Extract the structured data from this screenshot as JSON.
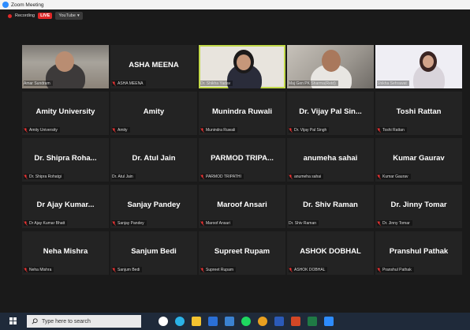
{
  "window": {
    "title": "Zoom Meeting"
  },
  "recording": {
    "label": "Recording",
    "live": "LIVE",
    "stream": "YouTube"
  },
  "tiles": [
    {
      "big": "",
      "name": "Amar Sundram",
      "muted": false,
      "video": "v1"
    },
    {
      "big": "ASHA MEENA",
      "name": "ASHA MEENA",
      "muted": true,
      "video": ""
    },
    {
      "big": "",
      "name": "Dr. Shikha Yadav",
      "muted": false,
      "video": "v3"
    },
    {
      "big": "",
      "name": "Maj Gen PK Sharma(Retd)",
      "muted": false,
      "video": "v4"
    },
    {
      "big": "",
      "name": "Shikha Sehrawat",
      "muted": false,
      "video": "v5"
    },
    {
      "big": "Amity University",
      "name": "Amity University",
      "muted": true
    },
    {
      "big": "Amity",
      "name": "Amity",
      "muted": true
    },
    {
      "big": "Munindra Ruwali",
      "name": "Munindra Ruwali",
      "muted": true
    },
    {
      "big": "Dr. Vijay Pal Sin...",
      "name": "Dr. Vijay Pal Singh",
      "muted": true
    },
    {
      "big": "Toshi Rattan",
      "name": "Toshi Rattan",
      "muted": true
    },
    {
      "big": "Dr. Shipra Roha...",
      "name": "Dr. Shipra Rohatgi",
      "muted": true
    },
    {
      "big": "Dr. Atul Jain",
      "name": "Dr. Atul Jain",
      "muted": false
    },
    {
      "big": "PARMOD TRIPA...",
      "name": "PARMOD TRIPATHI",
      "muted": true
    },
    {
      "big": "anumeha sahai",
      "name": "anumeha sahai",
      "muted": true
    },
    {
      "big": "Kumar Gaurav",
      "name": "Kumar Gaurav",
      "muted": true
    },
    {
      "big": "Dr Ajay Kumar...",
      "name": "Dr Ajay Kumar Bhatt",
      "muted": true
    },
    {
      "big": "Sanjay Pandey",
      "name": "Sanjay Pandey",
      "muted": true
    },
    {
      "big": "Maroof Ansari",
      "name": "Maroof Ansari",
      "muted": true
    },
    {
      "big": "Dr. Shiv Raman",
      "name": "Dr. Shiv Raman",
      "muted": false
    },
    {
      "big": "Dr. Jinny Tomar",
      "name": "Dr. Jinny Tomar",
      "muted": true
    },
    {
      "big": "Neha Mishra",
      "name": "Neha Mishra",
      "muted": true
    },
    {
      "big": "Sanjum Bedi",
      "name": "Sanjum Bedi",
      "muted": true
    },
    {
      "big": "Supreet Rupam",
      "name": "Supreet Rupam",
      "muted": true
    },
    {
      "big": "ASHOK DOBHAL",
      "name": "ASHOK DOBHAL",
      "muted": true
    },
    {
      "big": "Pranshul Pathak",
      "name": "Pranshul Pathak",
      "muted": true
    }
  ],
  "taskbar": {
    "search_placeholder": "Type here to search",
    "icons": [
      {
        "name": "cortana-icon",
        "color": "#ffffff"
      },
      {
        "name": "edge-icon",
        "color": "#2bb3e8"
      },
      {
        "name": "file-explorer-icon",
        "color": "#f2c230"
      },
      {
        "name": "calendar-icon",
        "color": "#2a6fd6"
      },
      {
        "name": "store-icon",
        "color": "#3b82d1"
      },
      {
        "name": "spotify-icon",
        "color": "#1ed760"
      },
      {
        "name": "chrome-icon",
        "color": "#e8a020"
      },
      {
        "name": "word-icon",
        "color": "#2b5ab8"
      },
      {
        "name": "powerpoint-icon",
        "color": "#d24726"
      },
      {
        "name": "excel-icon",
        "color": "#1f7a45"
      },
      {
        "name": "zoom-icon",
        "color": "#2d8cff"
      }
    ]
  }
}
